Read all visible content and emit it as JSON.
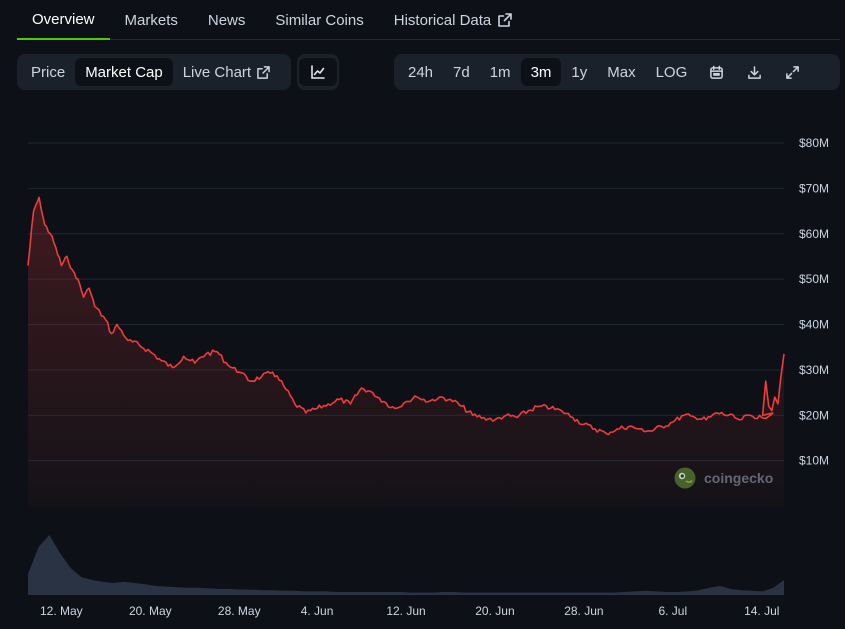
{
  "tabs": [
    {
      "label": "Overview",
      "active": true
    },
    {
      "label": "Markets"
    },
    {
      "label": "News"
    },
    {
      "label": "Similar Coins"
    },
    {
      "label": "Historical Data",
      "external": true
    }
  ],
  "toolbar": {
    "chart_types": [
      "Price",
      "Market Cap",
      "Live Chart"
    ],
    "active_chart_type": "Market Cap",
    "ranges": [
      "24h",
      "7d",
      "1m",
      "3m",
      "1y",
      "Max",
      "LOG"
    ],
    "active_range": "3m",
    "icons": [
      "line-chart-icon",
      "calendar-icon",
      "download-icon",
      "expand-icon"
    ]
  },
  "watermark": "coingecko",
  "colors": {
    "line": "#f23b3b",
    "accent": "#4bcc00",
    "volume": "#2d3748"
  },
  "chart_data": {
    "type": "area",
    "title": "",
    "xlabel": "",
    "ylabel": "",
    "ylim": [
      0,
      80
    ],
    "y_unit": "M USD",
    "x_range": [
      "2024-05-09",
      "2024-07-16"
    ],
    "y_ticks": [
      "$10M",
      "$20M",
      "$30M",
      "$40M",
      "$50M",
      "$60M",
      "$70M",
      "$80M"
    ],
    "y_tick_values": [
      10,
      20,
      30,
      40,
      50,
      60,
      70,
      80
    ],
    "x_ticks": [
      "12. May",
      "20. May",
      "28. May",
      "4. Jun",
      "12. Jun",
      "20. Jun",
      "28. Jun",
      "6. Jul",
      "14. Jul"
    ],
    "x_tick_dates": [
      "2024-05-12",
      "2024-05-20",
      "2024-05-28",
      "2024-06-04",
      "2024-06-12",
      "2024-06-20",
      "2024-06-28",
      "2024-07-06",
      "2024-07-14"
    ],
    "series": [
      {
        "values": [
          [
            "2024-05-09",
            53
          ],
          [
            "2024-05-09",
            65
          ],
          [
            "2024-05-10",
            68
          ],
          [
            "2024-05-10",
            62
          ],
          [
            "2024-05-11",
            60
          ],
          [
            "2024-05-11",
            57
          ],
          [
            "2024-05-12",
            53
          ],
          [
            "2024-05-12",
            55
          ],
          [
            "2024-05-13",
            52
          ],
          [
            "2024-05-13",
            50
          ],
          [
            "2024-05-14",
            46
          ],
          [
            "2024-05-14",
            48
          ],
          [
            "2024-05-15",
            44
          ],
          [
            "2024-05-16",
            41
          ],
          [
            "2024-05-16",
            38
          ],
          [
            "2024-05-17",
            40
          ],
          [
            "2024-05-18",
            36.5
          ],
          [
            "2024-05-19",
            35.5
          ],
          [
            "2024-05-20",
            34
          ],
          [
            "2024-05-21",
            32
          ],
          [
            "2024-05-22",
            30.5
          ],
          [
            "2024-05-23",
            33
          ],
          [
            "2024-05-24",
            31.5
          ],
          [
            "2024-05-25",
            33.5
          ],
          [
            "2024-05-26",
            34
          ],
          [
            "2024-05-27",
            31
          ],
          [
            "2024-05-28",
            29.5
          ],
          [
            "2024-05-29",
            27.5
          ],
          [
            "2024-05-30",
            28.5
          ],
          [
            "2024-05-31",
            29.5
          ],
          [
            "2024-06-01",
            26.5
          ],
          [
            "2024-06-02",
            22.5
          ],
          [
            "2024-06-03",
            20.5
          ],
          [
            "2024-06-04",
            21.5
          ],
          [
            "2024-06-05",
            22.5
          ],
          [
            "2024-06-06",
            23.5
          ],
          [
            "2024-06-07",
            22.5
          ],
          [
            "2024-06-08",
            26
          ],
          [
            "2024-06-09",
            25
          ],
          [
            "2024-06-10",
            23
          ],
          [
            "2024-06-11",
            21.5
          ],
          [
            "2024-06-12",
            23
          ],
          [
            "2024-06-13",
            24
          ],
          [
            "2024-06-14",
            23
          ],
          [
            "2024-06-15",
            24
          ],
          [
            "2024-06-16",
            23.5
          ],
          [
            "2024-06-17",
            22
          ],
          [
            "2024-06-18",
            20
          ],
          [
            "2024-06-19",
            19.5
          ],
          [
            "2024-06-20",
            19
          ],
          [
            "2024-06-21",
            20
          ],
          [
            "2024-06-22",
            19.5
          ],
          [
            "2024-06-23",
            21
          ],
          [
            "2024-06-24",
            22
          ],
          [
            "2024-06-25",
            21.5
          ],
          [
            "2024-06-26",
            21
          ],
          [
            "2024-06-27",
            19.5
          ],
          [
            "2024-06-28",
            18
          ],
          [
            "2024-06-29",
            17
          ],
          [
            "2024-06-30",
            16
          ],
          [
            "2024-07-01",
            17
          ],
          [
            "2024-07-02",
            17.5
          ],
          [
            "2024-07-03",
            17
          ],
          [
            "2024-07-04",
            16.5
          ],
          [
            "2024-07-05",
            17.5
          ],
          [
            "2024-07-06",
            18.5
          ],
          [
            "2024-07-07",
            20
          ],
          [
            "2024-07-08",
            19.5
          ],
          [
            "2024-07-09",
            19
          ],
          [
            "2024-07-10",
            20.5
          ],
          [
            "2024-07-11",
            20
          ],
          [
            "2024-07-12",
            19
          ],
          [
            "2024-07-13",
            20
          ],
          [
            "2024-07-14",
            19.5
          ],
          [
            "2024-07-15",
            20.5
          ],
          [
            "2024-07-16",
            20
          ],
          [
            "2024-07-16",
            27.5
          ],
          [
            "2024-07-16",
            22
          ],
          [
            "2024-07-16",
            21
          ],
          [
            "2024-07-16",
            24
          ],
          [
            "2024-07-16",
            22.5
          ],
          [
            "2024-07-16",
            28.5
          ],
          [
            "2024-07-16",
            33.5
          ]
        ]
      }
    ],
    "volume": {
      "relative": true,
      "values": [
        0.35,
        0.8,
        1.0,
        0.7,
        0.45,
        0.3,
        0.25,
        0.22,
        0.2,
        0.22,
        0.2,
        0.18,
        0.15,
        0.14,
        0.13,
        0.12,
        0.12,
        0.11,
        0.1,
        0.1,
        0.09,
        0.09,
        0.08,
        0.08,
        0.07,
        0.07,
        0.06,
        0.06,
        0.06,
        0.05,
        0.05,
        0.05,
        0.05,
        0.05,
        0.05,
        0.05,
        0.04,
        0.04,
        0.04,
        0.05,
        0.05,
        0.04,
        0.04,
        0.04,
        0.04,
        0.04,
        0.04,
        0.04,
        0.04,
        0.04,
        0.04,
        0.04,
        0.04,
        0.04,
        0.04,
        0.04,
        0.05,
        0.06,
        0.07,
        0.06,
        0.05,
        0.05,
        0.06,
        0.08,
        0.12,
        0.15,
        0.1,
        0.08,
        0.07,
        0.06,
        0.12,
        0.25
      ]
    }
  }
}
